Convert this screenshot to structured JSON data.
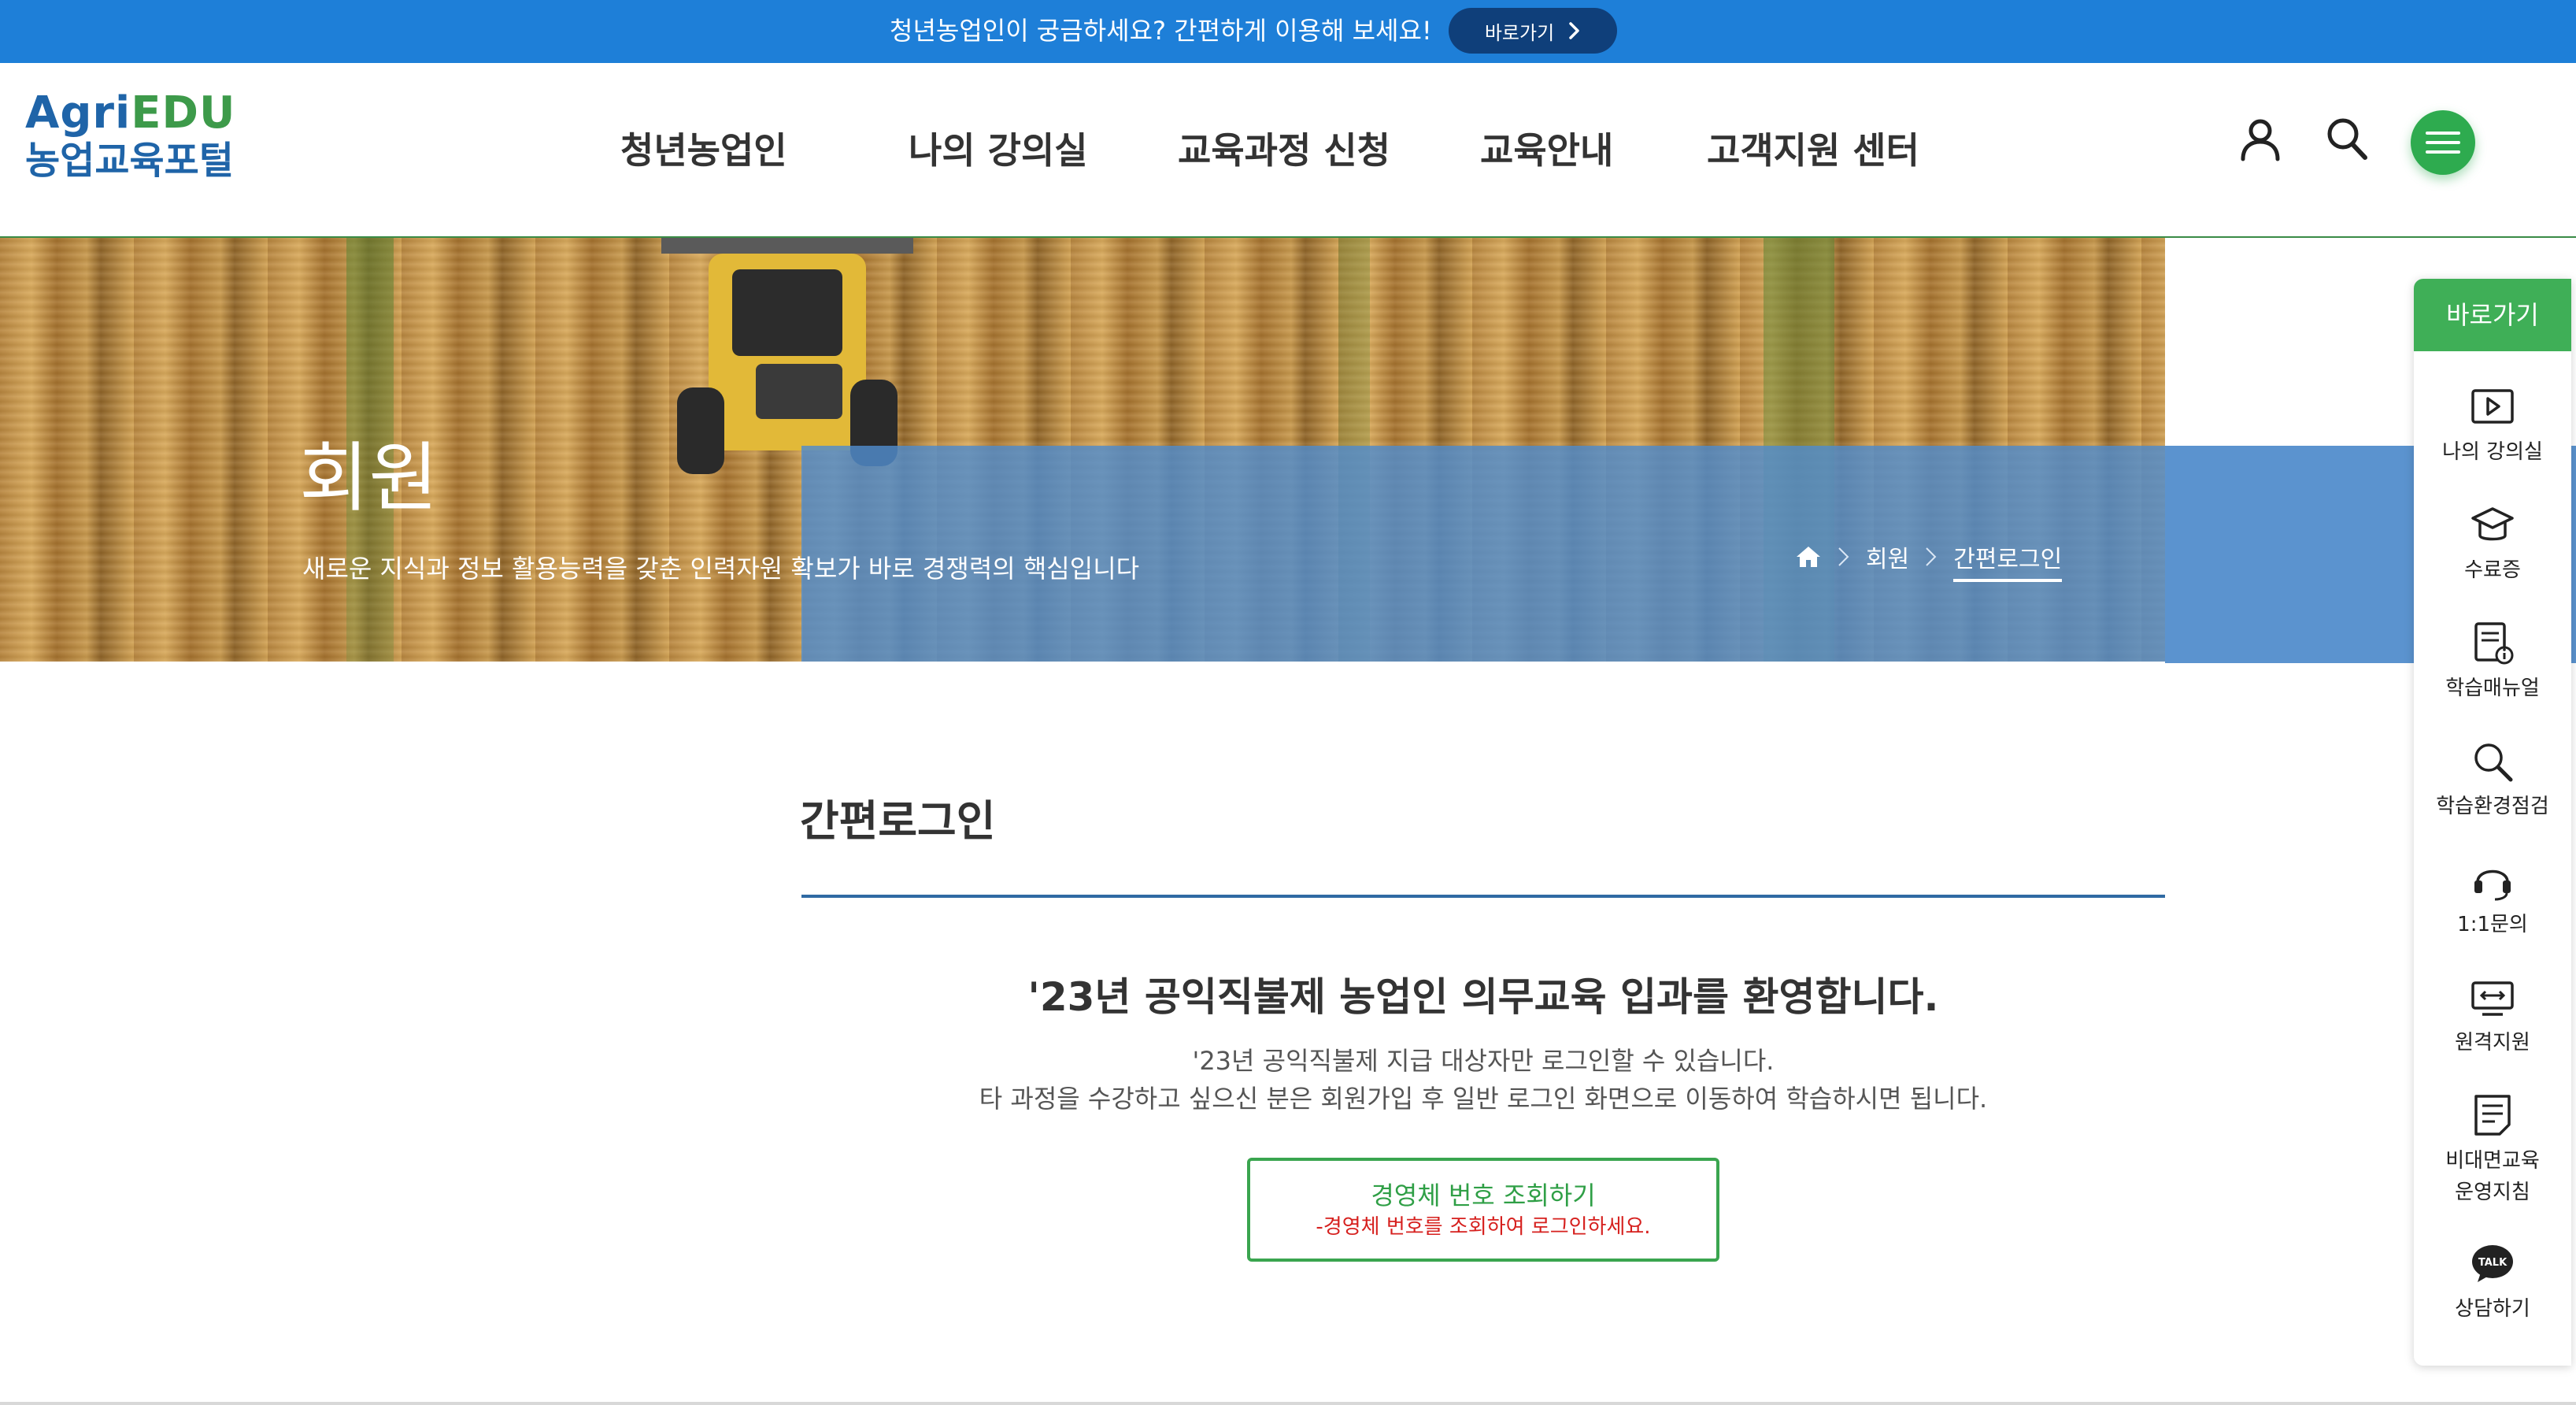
{
  "top_banner": {
    "text": "청년농업인이 궁금하세요? 간편하게 이용해 보세요!",
    "button_label": "바로가기"
  },
  "logo": {
    "en_part1": "Agri",
    "en_part2": "EDU",
    "ko": "농업교육포털"
  },
  "gnb": {
    "items": [
      "청년농업인",
      "나의 강의실",
      "교육과정 신청",
      "교육안내",
      "고객지원 센터"
    ]
  },
  "header_icons": [
    "user-icon",
    "search-icon",
    "hamburger-menu-icon"
  ],
  "hero": {
    "title": "회원",
    "subtitle": "새로운 지식과 정보 활용능력을 갖춘 인력자원 확보가 바로 경쟁력의 핵심입니다",
    "breadcrumb": {
      "home_icon": "home-icon",
      "level1": "회원",
      "current": "간편로그인"
    }
  },
  "quick_menu": {
    "title": "바로가기",
    "items": [
      {
        "icon": "play-icon",
        "label": "나의 강의실"
      },
      {
        "icon": "graduation-cap-icon",
        "label": "수료증"
      },
      {
        "icon": "manual-icon",
        "label": "학습매뉴얼"
      },
      {
        "icon": "magnifier-icon",
        "label": "학습환경점검"
      },
      {
        "icon": "headset-icon",
        "label": "1:1문의"
      },
      {
        "icon": "remote-monitor-icon",
        "label": "원격지원"
      },
      {
        "icon": "document-icon",
        "label": "비대면교육",
        "label2": "운영지침"
      },
      {
        "icon": "kakao-talk-icon",
        "label": "상담하기",
        "badge": "TALK"
      }
    ]
  },
  "content": {
    "title": "간편로그인",
    "welcome": "'23년 공익직불제 농업인 의무교육 입과를 환영합니다.",
    "desc_line1": "'23년 공익직불제 지급 대상자만 로그인할 수 있습니다.",
    "desc_line2": "타 과정을 수강하고 싶으신 분은 회원가입 후 일반 로그인 화면으로 이동하여 학습하시면 됩니다.",
    "lookup_button": {
      "label": "경영체 번호 조회하기",
      "sub": "-경영체 번호를 조회하여 로그인하세요."
    }
  },
  "colors": {
    "banner_bg": "#1e7fd8",
    "banner_button": "#0f3f7a",
    "brand_blue": "#1f64a8",
    "brand_green": "#3d9a4a",
    "quick_head": "#3faf57",
    "hero_overlay": "#508ccd",
    "rule": "#2f6aa3",
    "warning_red": "#d6201e"
  }
}
